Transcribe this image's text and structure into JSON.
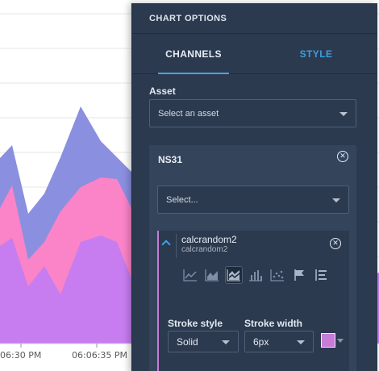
{
  "chart": {
    "x_ticks": [
      "06:30 PM",
      "06:06:35 PM"
    ],
    "colors": {
      "blue": "#8b8fe0",
      "pink": "#fa84c7",
      "purple": "#c77df0"
    }
  },
  "panel": {
    "title": "CHART OPTIONS",
    "tabs": [
      {
        "label": "CHANNELS",
        "active": true
      },
      {
        "label": "STYLE",
        "active": false
      }
    ],
    "asset": {
      "label": "Asset",
      "placeholder": "Select an asset"
    },
    "source": {
      "name": "NS31",
      "select_placeholder": "Select...",
      "channel": {
        "name": "calcrandom2",
        "subtitle": "calcrandom2",
        "color": "#c77dd8",
        "chart_type_icons": [
          "line-chart-icon",
          "area-chart-icon",
          "stacked-area-chart-icon",
          "bar-chart-icon",
          "scatter-chart-icon",
          "flag-icon",
          "list-icon"
        ],
        "active_icon": "stacked-area-chart-icon",
        "stroke_style": {
          "label": "Stroke style",
          "value": "Solid"
        },
        "stroke_width": {
          "label": "Stroke width",
          "value": "6px"
        }
      }
    }
  }
}
